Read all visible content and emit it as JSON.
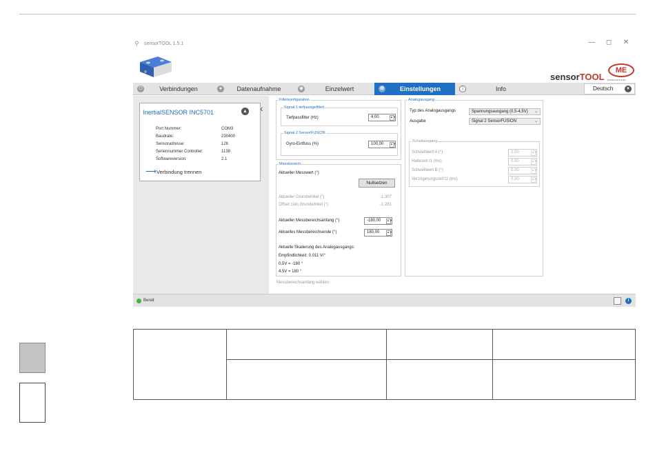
{
  "window": {
    "title": "sensorTOOL 1.5.1",
    "controls": {
      "minimize": "—",
      "maximize": "◻",
      "close": "✕"
    }
  },
  "brand": {
    "name_a": "sensor",
    "name_b": "TOOL",
    "logo_text": "ME",
    "logo_sub": "MICRO-EPSILON"
  },
  "tabs": [
    {
      "label": "Verbindungen",
      "icon": "plug-icon"
    },
    {
      "label": "Datenaufnahme",
      "icon": "record-icon"
    },
    {
      "label": "Einzelwert",
      "icon": "value-icon"
    },
    {
      "label": "Einstellungen",
      "icon": "settings-icon",
      "active": true
    },
    {
      "label": "Info",
      "icon": "info-icon"
    }
  ],
  "language": "Deutsch",
  "device": {
    "title": "InertialSENSOR INC5701",
    "rows": [
      {
        "k": "Port Nummer:",
        "v": "COM3"
      },
      {
        "k": "Baudrate:",
        "v": "230400"
      },
      {
        "k": "Sensoradresse:",
        "v": "126"
      },
      {
        "k": "Seriennummer Controller:",
        "v": "1138"
      },
      {
        "k": "Softwareversion:",
        "v": "2.1"
      }
    ],
    "disconnect": "Verbindung trennen"
  },
  "filter": {
    "legend": "Filterkonfiguration",
    "signal1": {
      "legend": "Signal 1 tiefpassgefiltert",
      "label": "Tiefpassfilter (Hz)",
      "value": "4,00"
    },
    "signal2": {
      "legend": "Signal 2 SensorFUSION",
      "label": "Gyro-Einfluss (%)",
      "value": "100,00"
    }
  },
  "messbereich": {
    "legend": "Messbereich",
    "current_label": "Aktueller Messwert (°)",
    "zero_button": "Nullsetzen",
    "base_label": "Aktueller Grundwinkel (°)",
    "base_value": "-1.307",
    "offset_label": "Offset zum Grundwinkel (°)",
    "offset_value": "-1.281",
    "start_label": "Aktueller Messbereichsanfang (°)",
    "start_value": "-180,00",
    "end_label": "Aktuelles Messbereichsende (°)",
    "end_value": "180,00",
    "scale_title": "Aktuelle Skalierung des Analogausgangs:",
    "sensitivity": "Empfindlichkeit: 0.011 V/°",
    "low": "0.5V = -180 °",
    "high": "4.5V = 180 °",
    "hint": "Messbereichsanfang wählen"
  },
  "analog": {
    "legend": "Analogausgang",
    "type_label": "Typ des Analogausgangs",
    "type_value": "Spannungsausgang (0,5-4,5V)",
    "output_label": "Ausgabe",
    "output_value": "Signal 2 SensorFUSION"
  },
  "switch": {
    "legend": "Schaltausgang",
    "rows": [
      {
        "label": "Schwellwert A (°)",
        "value": "0,00"
      },
      {
        "label": "Haltezeit t1 (ms)",
        "value": "0,00"
      },
      {
        "label": "Schwellwert B (°)",
        "value": "0,00"
      },
      {
        "label": "Verzögerungszeit t2 (ms)",
        "value": "0,00"
      }
    ]
  },
  "status": {
    "text": "Bereit",
    "color": "#3fb53f"
  },
  "colors": {
    "accent": "#1f6fc2",
    "brand_red": "#c0392b"
  }
}
